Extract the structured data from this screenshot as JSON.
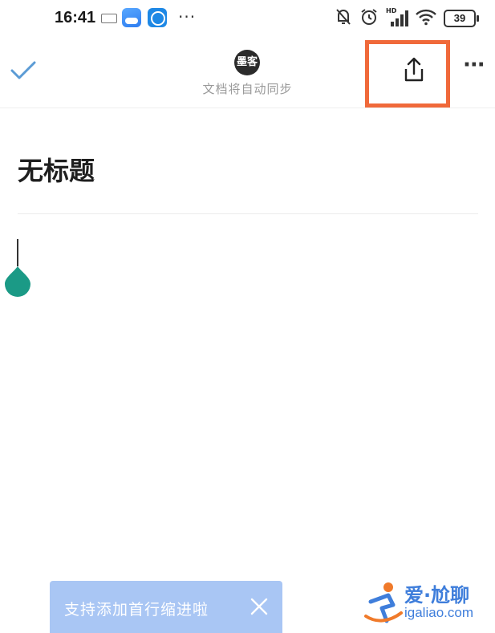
{
  "status_bar": {
    "time": "16:41",
    "battery": "39",
    "network": "HD"
  },
  "toolbar": {
    "sync_status": "文档将自动同步",
    "avatar_text": "墨客"
  },
  "document": {
    "title": "无标题"
  },
  "toast": {
    "message": "支持添加首行缩进啦"
  },
  "watermark": {
    "brand": "爱·尬聊",
    "url": "igaliao.com"
  },
  "colors": {
    "accent_check": "#5b9bd5",
    "highlight_box": "#f0693a",
    "cursor_handle": "#1b9a86",
    "toast_bg": "#a9c6f4"
  }
}
